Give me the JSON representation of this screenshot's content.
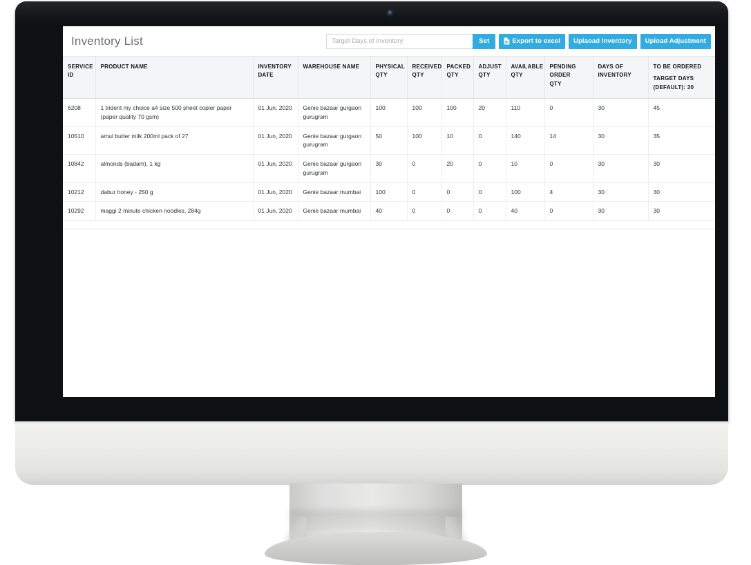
{
  "header": {
    "title": "Inventory List"
  },
  "toolbar": {
    "target_days_placeholder": "Target Days of Inventory",
    "target_days_value": "",
    "set_label": "Set",
    "export_label": "Export to excel",
    "upload_inventory_label": "Uplaoad Inventory",
    "upload_adjustment_label": "Upload Adjustment",
    "accent_color": "#32ace0"
  },
  "table": {
    "columns": [
      {
        "key": "service_id",
        "line1": "SERVICE",
        "line2": "ID"
      },
      {
        "key": "product_name",
        "line1": "PRODUCT NAME",
        "line2": ""
      },
      {
        "key": "inventory_date",
        "line1": "INVENTORY",
        "line2": "DATE"
      },
      {
        "key": "warehouse_name",
        "line1": "WAREHOUSE NAME",
        "line2": ""
      },
      {
        "key": "physical_qty",
        "line1": "PHYSICAL",
        "line2": "QTY"
      },
      {
        "key": "received_qty",
        "line1": "RECEIVED",
        "line2": "QTY"
      },
      {
        "key": "packed_qty",
        "line1": "PACKED",
        "line2": "QTY"
      },
      {
        "key": "adjust_qty",
        "line1": "ADJUST",
        "line2": "QTY"
      },
      {
        "key": "available_qty",
        "line1": "AVAILABLE",
        "line2": "QTY"
      },
      {
        "key": "pending_order_qty",
        "line1": "PENDING ORDER",
        "line2": "QTY"
      },
      {
        "key": "days_of_inventory",
        "line1": "DAYS OF",
        "line2": "INVENTORY"
      },
      {
        "key": "to_be_ordered",
        "line1": "TO BE ORDERED",
        "line2": "TARGET DAYS",
        "line3": "(DEFAULT): 30"
      }
    ],
    "rows": [
      {
        "service_id": "6208",
        "product_name": "1 trident my choice a4 size 500 sheet copier paper (paper quality 70 gsm)",
        "inventory_date": "01 Jun, 2020",
        "warehouse_name": "Genie bazaar gurgaon gurugram",
        "physical_qty": "100",
        "received_qty": "100",
        "packed_qty": "100",
        "adjust_qty": "20",
        "available_qty": "110",
        "pending_order_qty": "0",
        "days_of_inventory": "30",
        "to_be_ordered": "45"
      },
      {
        "service_id": "10510",
        "product_name": "amul butter milk 200ml pack of 27",
        "inventory_date": "01 Jun, 2020",
        "warehouse_name": "Genie bazaar gurgaon gurugram",
        "physical_qty": "50",
        "received_qty": "100",
        "packed_qty": "10",
        "adjust_qty": "0",
        "available_qty": "140",
        "pending_order_qty": "14",
        "days_of_inventory": "30",
        "to_be_ordered": "35"
      },
      {
        "service_id": "10842",
        "product_name": "almonds (badam), 1 kg",
        "inventory_date": "01 Jun, 2020",
        "warehouse_name": "Genie bazaar gurgaon gurugram",
        "physical_qty": "30",
        "received_qty": "0",
        "packed_qty": "20",
        "adjust_qty": "0",
        "available_qty": "10",
        "pending_order_qty": "0",
        "days_of_inventory": "30",
        "to_be_ordered": "30"
      },
      {
        "service_id": "10212",
        "product_name": "dabur honey - 250 g",
        "inventory_date": "01 Jun, 2020",
        "warehouse_name": "Genie bazaar mumbai",
        "physical_qty": "100",
        "received_qty": "0",
        "packed_qty": "0",
        "adjust_qty": "0",
        "available_qty": "100",
        "pending_order_qty": "4",
        "days_of_inventory": "30",
        "to_be_ordered": "30"
      },
      {
        "service_id": "10292",
        "product_name": "maggi 2 minute chicken noodles, 284g",
        "inventory_date": "01 Jun, 2020",
        "warehouse_name": "Genie bazaar mumbai",
        "physical_qty": "40",
        "received_qty": "0",
        "packed_qty": "0",
        "adjust_qty": "0",
        "available_qty": "40",
        "pending_order_qty": "0",
        "days_of_inventory": "30",
        "to_be_ordered": "30"
      }
    ]
  }
}
